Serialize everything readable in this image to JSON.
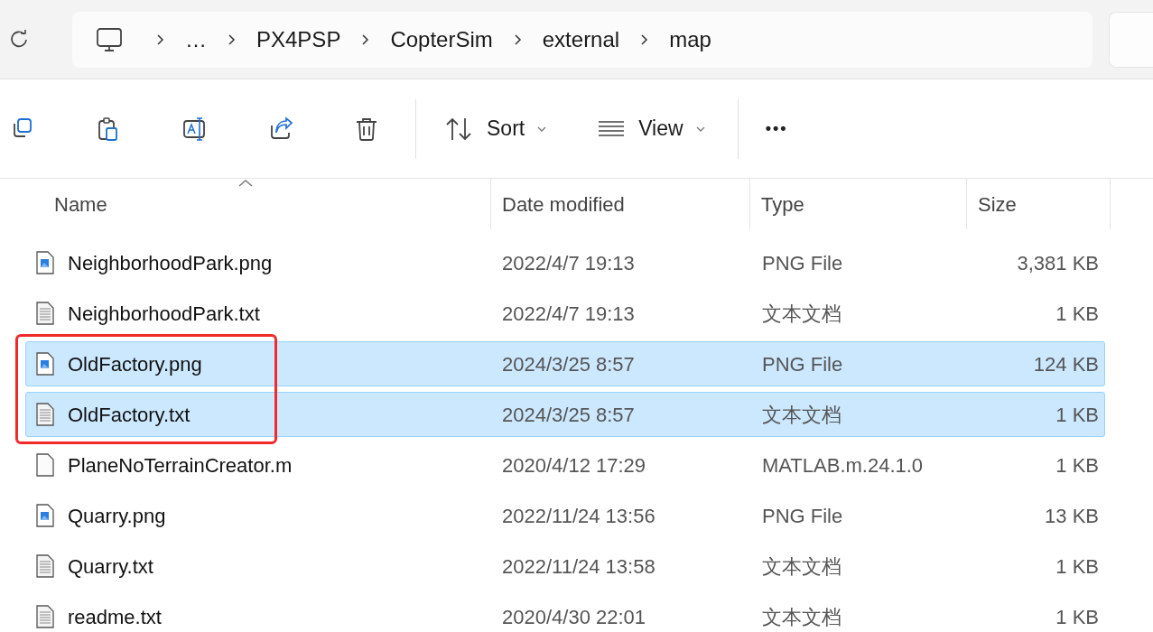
{
  "address_bar": {
    "segments": [
      "…",
      "PX4PSP",
      "CopterSim",
      "external",
      "map"
    ]
  },
  "toolbar": {
    "sort": "Sort",
    "view": "View",
    "more": "•••"
  },
  "columns": [
    {
      "label": "Name",
      "sorted": true
    },
    {
      "label": "Date modified",
      "sorted": false
    },
    {
      "label": "Type",
      "sorted": false
    },
    {
      "label": "Size",
      "sorted": false
    }
  ],
  "rows": [
    {
      "kind": "image",
      "name": "NeighborhoodPark.png",
      "date": "2022/4/7 19:13",
      "type": "PNG File",
      "size": "3,381 KB",
      "selected": false,
      "highlighted": false
    },
    {
      "kind": "text",
      "name": "NeighborhoodPark.txt",
      "date": "2022/4/7 19:13",
      "type": "文本文档",
      "size": "1 KB",
      "selected": false,
      "highlighted": false
    },
    {
      "kind": "image",
      "name": "OldFactory.png",
      "date": "2024/3/25 8:57",
      "type": "PNG File",
      "size": "124 KB",
      "selected": true,
      "highlighted": true
    },
    {
      "kind": "text",
      "name": "OldFactory.txt",
      "date": "2024/3/25 8:57",
      "type": "文本文档",
      "size": "1 KB",
      "selected": true,
      "highlighted": true
    },
    {
      "kind": "blank",
      "name": "PlaneNoTerrainCreator.m",
      "date": "2020/4/12 17:29",
      "type": "MATLAB.m.24.1.0",
      "size": "1 KB",
      "selected": false,
      "highlighted": false
    },
    {
      "kind": "image",
      "name": "Quarry.png",
      "date": "2022/11/24 13:56",
      "type": "PNG File",
      "size": "13 KB",
      "selected": false,
      "highlighted": false
    },
    {
      "kind": "text",
      "name": "Quarry.txt",
      "date": "2022/11/24 13:58",
      "type": "文本文档",
      "size": "1 KB",
      "selected": false,
      "highlighted": false
    },
    {
      "kind": "text",
      "name": "readme.txt",
      "date": "2020/4/30 22:01",
      "type": "文本文档",
      "size": "1 KB",
      "selected": false,
      "highlighted": false
    }
  ]
}
